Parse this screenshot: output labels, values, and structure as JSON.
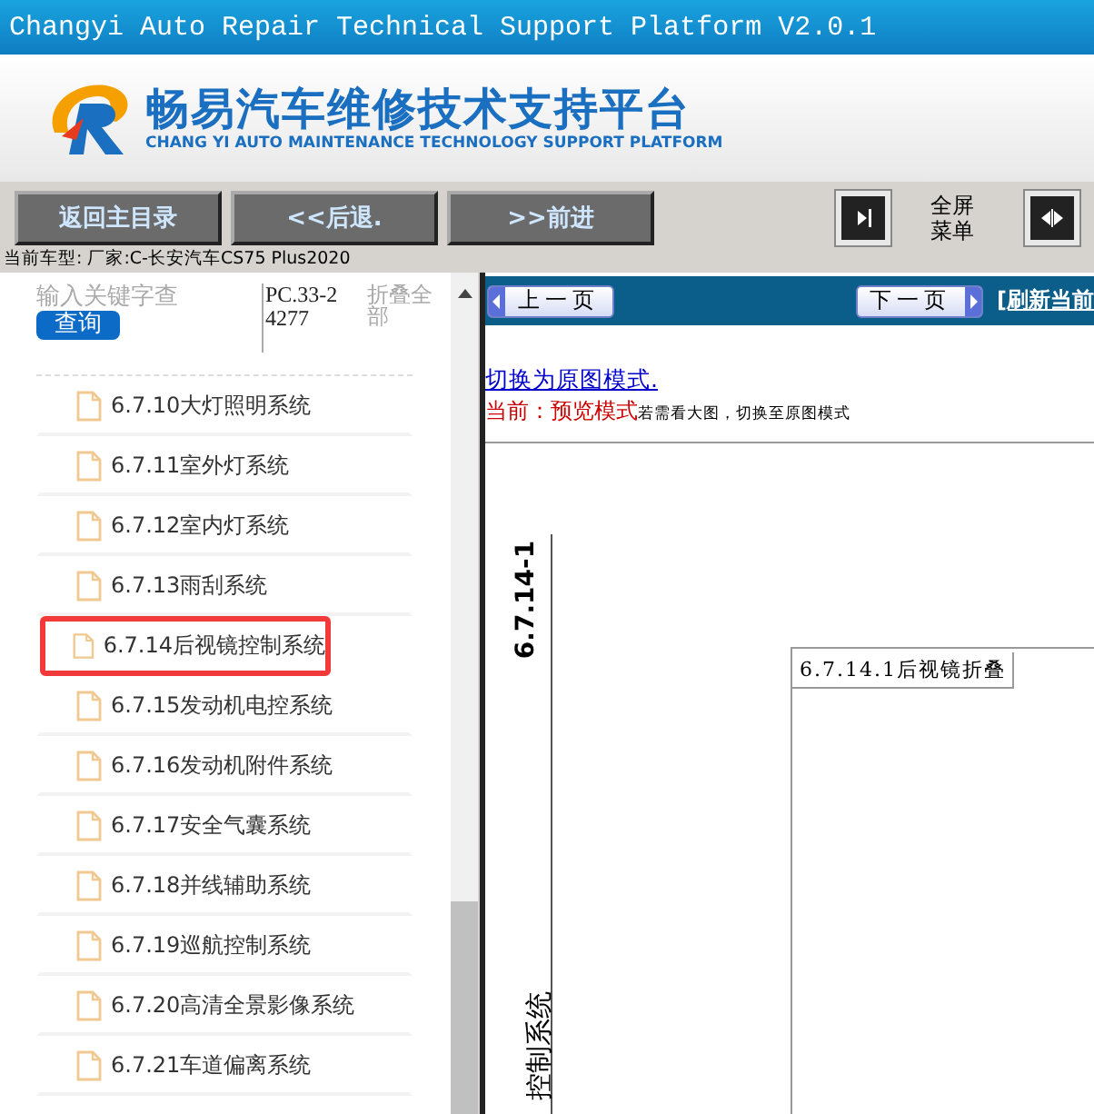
{
  "window": {
    "title": "Changyi Auto Repair Technical Support Platform V2.0.1"
  },
  "banner": {
    "title": "畅易汽车维修技术支持平台",
    "subtitle": "CHANG YI AUTO MAINTENANCE TECHNOLOGY SUPPORT PLATFORM"
  },
  "toolbar": {
    "buttons": [
      "返回主目录",
      "<<后退.",
      ">>前进"
    ],
    "fullscreen_label": "全屏菜单"
  },
  "model_line": "当前车型:  厂家:C-长安汽车CS75 Plus2020",
  "sidebar": {
    "search": {
      "placeholder": "输入关键字查"
    },
    "search_button": "查询",
    "code": "PC.33-24277",
    "collapse_all": "折叠全部",
    "items": [
      {
        "label": "6.7.10大灯照明系统",
        "highlighted": false
      },
      {
        "label": "6.7.11室外灯系统",
        "highlighted": false
      },
      {
        "label": "6.7.12室内灯系统",
        "highlighted": false
      },
      {
        "label": "6.7.13雨刮系统",
        "highlighted": false
      },
      {
        "label": "6.7.14后视镜控制系统",
        "highlighted": true
      },
      {
        "label": "6.7.15发动机电控系统",
        "highlighted": false
      },
      {
        "label": "6.7.16发动机附件系统",
        "highlighted": false
      },
      {
        "label": "6.7.17安全气囊系统",
        "highlighted": false
      },
      {
        "label": "6.7.18并线辅助系统",
        "highlighted": false
      },
      {
        "label": "6.7.19巡航控制系统",
        "highlighted": false
      },
      {
        "label": "6.7.20高清全景影像系统",
        "highlighted": false
      },
      {
        "label": "6.7.21车道偏离系统",
        "highlighted": false
      }
    ]
  },
  "viewer": {
    "prev_button": "上一页",
    "next_button": "下一页",
    "refresh_link": "[刷新当前",
    "switch_link": "切换为原图模式.",
    "mode_label": "当前：预览模式",
    "mode_hint": "若需看大图，切换至原图模式",
    "document": {
      "page_number": "6.7.14-1",
      "section_title": "控制系统",
      "figure_caption": "6.7.14.1后视镜折叠"
    }
  }
}
